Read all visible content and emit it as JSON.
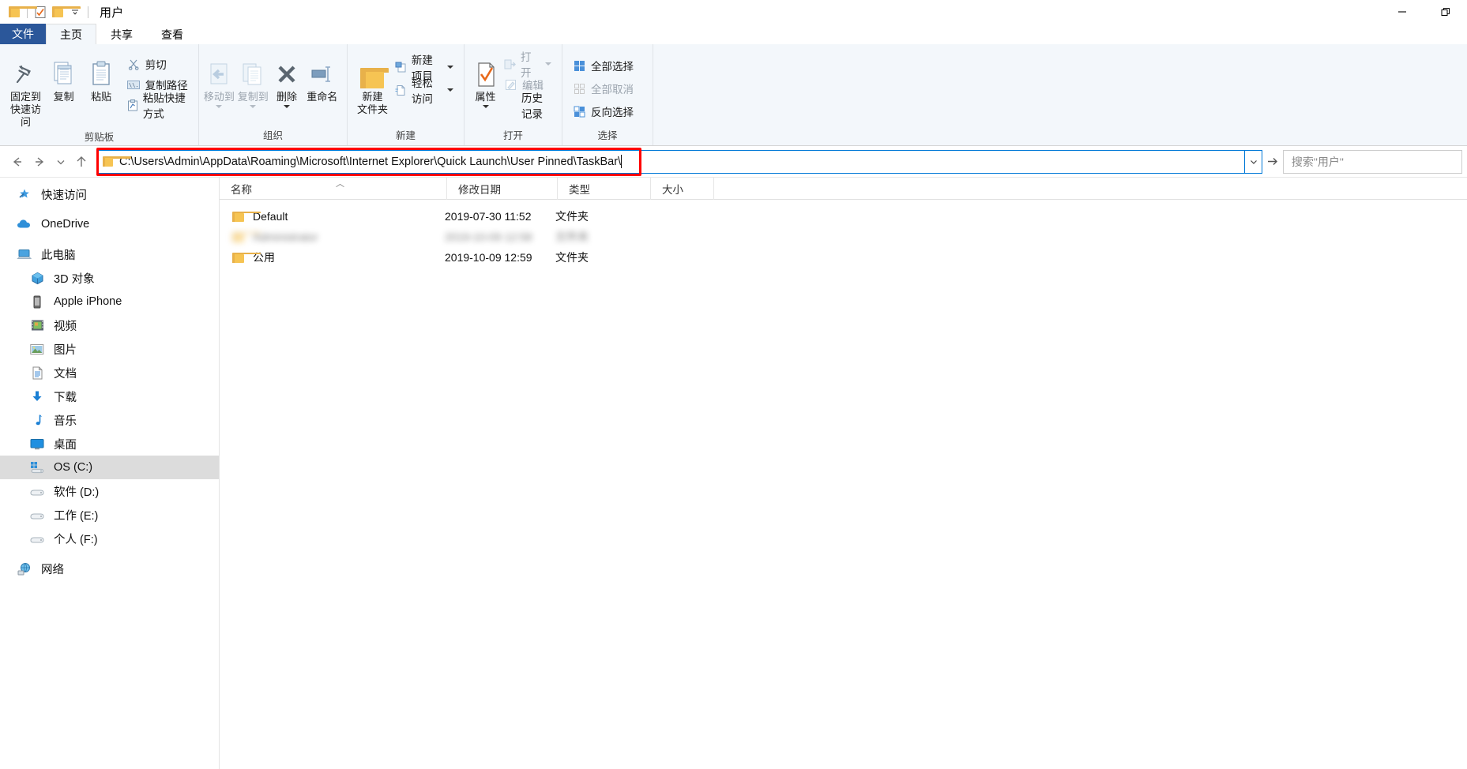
{
  "window": {
    "title": "用户",
    "quick_access_icons": [
      "folder-icon",
      "properties-icon",
      "new-folder-icon",
      "customize-chevron-icon"
    ],
    "caption_buttons": [
      {
        "name": "minimize-button",
        "glyph": "—"
      },
      {
        "name": "restore-button",
        "glyph": "❐"
      }
    ]
  },
  "ribbon": {
    "tabs": [
      {
        "label": "文件",
        "name": "tab-file",
        "active": false
      },
      {
        "label": "主页",
        "name": "tab-home",
        "active": true
      },
      {
        "label": "共享",
        "name": "tab-share",
        "active": false
      },
      {
        "label": "查看",
        "name": "tab-view",
        "active": false
      }
    ],
    "groups": [
      {
        "label": "剪贴板",
        "name": "group-clipboard",
        "big": [
          {
            "label": "固定到\n快速访问",
            "label_l1": "固定到",
            "label_l2": "快速访问",
            "icon": "pin-icon",
            "disabled": false
          },
          {
            "label": "复制",
            "label_l1": "复制",
            "label_l2": "",
            "icon": "copy-icon",
            "disabled": false
          },
          {
            "label": "粘贴",
            "label_l1": "粘贴",
            "label_l2": "",
            "icon": "paste-icon",
            "disabled": false
          }
        ],
        "small": [
          {
            "label": "剪切",
            "icon": "scissors-icon",
            "disabled": false
          },
          {
            "label": "复制路径",
            "icon": "copy-path-icon",
            "disabled": false
          },
          {
            "label": "粘贴快捷方式",
            "icon": "paste-shortcut-icon",
            "disabled": false
          }
        ]
      },
      {
        "label": "组织",
        "name": "group-organize",
        "big": [
          {
            "label_l1": "移动到",
            "label_l2": "",
            "icon": "move-to-icon",
            "disabled": true,
            "caret": true
          },
          {
            "label_l1": "复制到",
            "label_l2": "",
            "icon": "copy-to-icon",
            "disabled": true,
            "caret": true
          },
          {
            "label_l1": "删除",
            "label_l2": "",
            "icon": "delete-icon",
            "disabled": false,
            "caret": true
          },
          {
            "label_l1": "重命名",
            "label_l2": "",
            "icon": "rename-icon",
            "disabled": false,
            "caret": false
          }
        ],
        "small": []
      },
      {
        "label": "新建",
        "name": "group-new",
        "big": [
          {
            "label_l1": "新建",
            "label_l2": "文件夹",
            "icon": "new-folder-icon",
            "disabled": false
          }
        ],
        "small": [
          {
            "label": "新建项目",
            "icon": "new-item-icon",
            "disabled": false,
            "caret": true
          },
          {
            "label": "轻松访问",
            "icon": "easy-access-icon",
            "disabled": false,
            "caret": true
          }
        ]
      },
      {
        "label": "打开",
        "name": "group-open",
        "big": [
          {
            "label_l1": "属性",
            "label_l2": "",
            "icon": "properties-icon",
            "disabled": false,
            "caret": true
          }
        ],
        "small": [
          {
            "label": "打开",
            "icon": "open-icon",
            "disabled": true,
            "caret": true
          },
          {
            "label": "编辑",
            "icon": "edit-icon",
            "disabled": true,
            "caret": false
          },
          {
            "label": "历史记录",
            "icon": "history-icon",
            "disabled": false,
            "caret": false
          }
        ]
      },
      {
        "label": "选择",
        "name": "group-select",
        "big": [],
        "small": [
          {
            "label": "全部选择",
            "icon": "select-all-icon",
            "disabled": false,
            "caret": false
          },
          {
            "label": "全部取消",
            "icon": "select-none-icon",
            "disabled": true,
            "caret": false
          },
          {
            "label": "反向选择",
            "icon": "invert-selection-icon",
            "disabled": false,
            "caret": false
          }
        ]
      }
    ]
  },
  "nav_toolbar": {
    "back_icon": "arrow-left-icon",
    "forward_icon": "arrow-right-icon",
    "recent_icon": "chevron-down-icon",
    "up_icon": "arrow-up-icon",
    "address_value": "C:\\Users\\Admin\\AppData\\Roaming\\Microsoft\\Internet Explorer\\Quick Launch\\User Pinned\\TaskBar\\",
    "address_dropdown_icon": "chevron-down-icon",
    "go_icon": "go-arrow-icon",
    "search_placeholder": "搜索\"用户\"",
    "highlight_color": "#ff0000",
    "focus_border_color": "#0078d7"
  },
  "sidebar": {
    "items": [
      {
        "label": "快速访问",
        "icon": "star-pin-icon",
        "level": 1,
        "selected": false,
        "gap_after": true
      },
      {
        "label": "OneDrive",
        "icon": "onedrive-cloud-icon",
        "level": 1,
        "selected": false,
        "gap_after": true
      },
      {
        "label": "此电脑",
        "icon": "this-pc-icon",
        "level": 1,
        "selected": false,
        "gap_after": false
      },
      {
        "label": "3D 对象",
        "icon": "3d-objects-icon",
        "level": 2,
        "selected": false,
        "gap_after": false
      },
      {
        "label": "Apple iPhone",
        "icon": "apple-iphone-icon",
        "level": 2,
        "selected": false,
        "gap_after": false
      },
      {
        "label": "视频",
        "icon": "videos-icon",
        "level": 2,
        "selected": false,
        "gap_after": false
      },
      {
        "label": "图片",
        "icon": "pictures-icon",
        "level": 2,
        "selected": false,
        "gap_after": false
      },
      {
        "label": "文档",
        "icon": "documents-icon",
        "level": 2,
        "selected": false,
        "gap_after": false
      },
      {
        "label": "下载",
        "icon": "downloads-icon",
        "level": 2,
        "selected": false,
        "gap_after": false
      },
      {
        "label": "音乐",
        "icon": "music-icon",
        "level": 2,
        "selected": false,
        "gap_after": false
      },
      {
        "label": "桌面",
        "icon": "desktop-icon",
        "level": 2,
        "selected": false,
        "gap_after": false
      },
      {
        "label": "OS (C:)",
        "icon": "windows-drive-icon",
        "level": 2,
        "selected": true,
        "gap_after": false
      },
      {
        "label": "软件 (D:)",
        "icon": "drive-icon",
        "level": 2,
        "selected": false,
        "gap_after": false
      },
      {
        "label": "工作 (E:)",
        "icon": "drive-icon",
        "level": 2,
        "selected": false,
        "gap_after": false
      },
      {
        "label": "个人 (F:)",
        "icon": "drive-icon",
        "level": 2,
        "selected": false,
        "gap_after": true
      },
      {
        "label": "网络",
        "icon": "network-icon",
        "level": 1,
        "selected": false,
        "gap_after": false
      }
    ]
  },
  "file_list": {
    "columns": [
      {
        "label": "名称",
        "name": "column-name",
        "sorted": true,
        "sort_dir": "asc"
      },
      {
        "label": "修改日期",
        "name": "column-date-modified",
        "sorted": false
      },
      {
        "label": "类型",
        "name": "column-type",
        "sorted": false
      },
      {
        "label": "大小",
        "name": "column-size",
        "sorted": false
      }
    ],
    "rows": [
      {
        "name": "Default",
        "date": "2019-07-30 11:52",
        "type": "文件夹",
        "size": "",
        "icon": "folder-icon",
        "redacted": false
      },
      {
        "name": "Administrator",
        "date": "2019-10-09 12:58",
        "type": "文件夹",
        "size": "",
        "icon": "folder-icon",
        "redacted": true
      },
      {
        "name": "公用",
        "date": "2019-10-09 12:59",
        "type": "文件夹",
        "size": "",
        "icon": "folder-icon",
        "redacted": false
      }
    ]
  }
}
